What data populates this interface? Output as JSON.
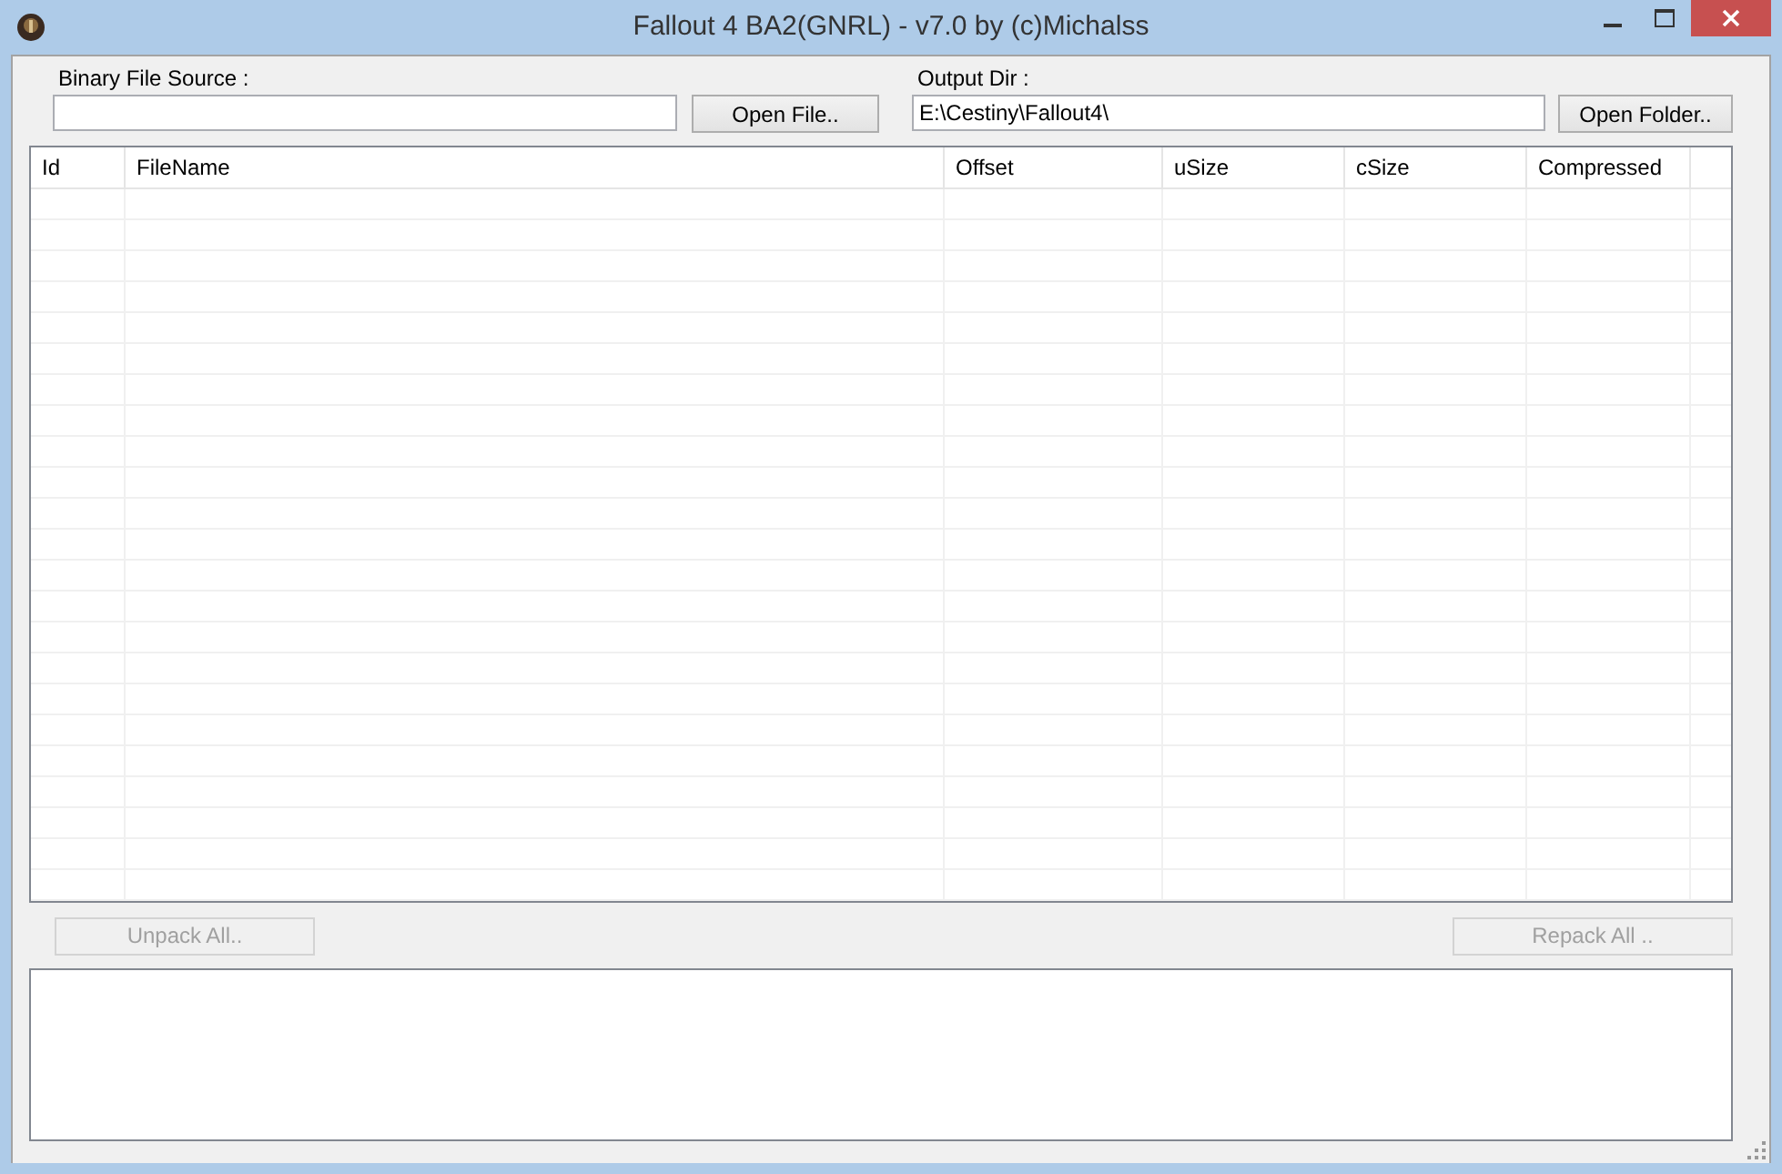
{
  "window": {
    "title": "Fallout 4 BA2(GNRL) - v7.0 by (c)Michalss"
  },
  "source": {
    "label": "Binary File Source :",
    "button": {
      "label": "Open File..",
      "disabled": false
    }
  },
  "output": {
    "label": "Output Dir  :",
    "value": "E:\\Cestiny\\Fallout4\\",
    "button": {
      "label": "Open Folder..",
      "disabled": false
    }
  },
  "table": {
    "columns": [
      "Id",
      "FileName",
      "Offset",
      "uSize",
      "cSize",
      "Compressed"
    ]
  },
  "actions": [
    {
      "label": "Unpack All..",
      "disabled": true
    },
    {
      "label": "Repack All ..",
      "disabled": true
    }
  ]
}
